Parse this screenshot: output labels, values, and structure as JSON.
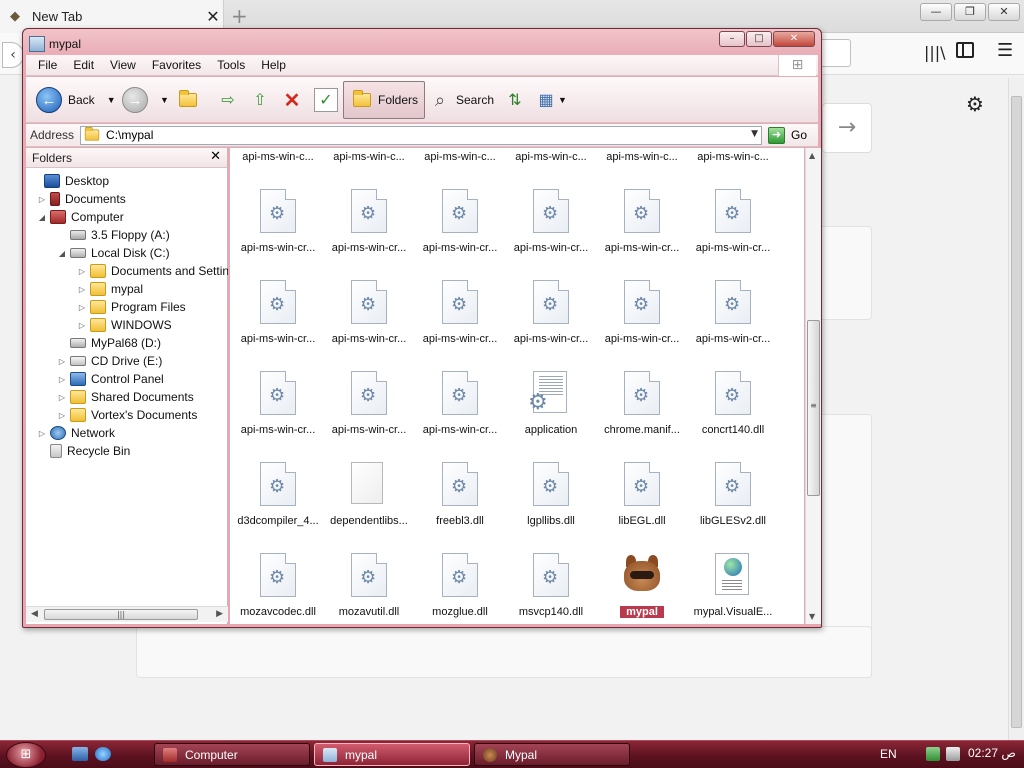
{
  "browser": {
    "tab_title": "New Tab",
    "close_tab": "✕",
    "new_tab": "+",
    "window_controls": [
      "—",
      "❐",
      "✕"
    ],
    "library_icon": "library-icon",
    "sidebar_icon": "sidebar-icon",
    "menu_icon": "hamburger-menu-icon",
    "gear_icon": "⚙",
    "go_arrow": "→"
  },
  "explorer": {
    "title": "mypal",
    "controls": [
      "–",
      "□",
      "✕"
    ],
    "menu": [
      "File",
      "Edit",
      "View",
      "Favorites",
      "Tools",
      "Help"
    ],
    "toolbar": {
      "back": "Back",
      "folders": "Folders",
      "search": "Search"
    },
    "address": {
      "label": "Address",
      "value": "C:\\mypal",
      "go": "Go"
    },
    "folders_pane": {
      "title": "Folders",
      "tree": [
        {
          "label": "Desktop",
          "icon": "desktop",
          "level": 0,
          "expander": ""
        },
        {
          "label": "Documents",
          "icon": "docs",
          "level": 1,
          "expander": "▷"
        },
        {
          "label": "Computer",
          "icon": "computer",
          "level": 1,
          "expander": "◢"
        },
        {
          "label": "3.5 Floppy (A:)",
          "icon": "floppy",
          "level": 2,
          "expander": ""
        },
        {
          "label": "Local Disk (C:)",
          "icon": "disk",
          "level": 2,
          "expander": "◢"
        },
        {
          "label": "Documents and Settings",
          "icon": "folder",
          "level": 3,
          "expander": "▷"
        },
        {
          "label": "mypal",
          "icon": "folder",
          "level": 3,
          "expander": "▷"
        },
        {
          "label": "Program Files",
          "icon": "folder",
          "level": 3,
          "expander": "▷"
        },
        {
          "label": "WINDOWS",
          "icon": "folder",
          "level": 3,
          "expander": "▷"
        },
        {
          "label": "MyPal68 (D:)",
          "icon": "disk",
          "level": 2,
          "expander": ""
        },
        {
          "label": "CD Drive (E:)",
          "icon": "cd",
          "level": 2,
          "expander": "▷"
        },
        {
          "label": "Control Panel",
          "icon": "cp",
          "level": 2,
          "expander": "▷"
        },
        {
          "label": "Shared Documents",
          "icon": "folder",
          "level": 2,
          "expander": "▷"
        },
        {
          "label": "Vortex's Documents",
          "icon": "folder",
          "level": 2,
          "expander": "▷"
        },
        {
          "label": "Network",
          "icon": "network",
          "level": 1,
          "expander": "▷"
        },
        {
          "label": "Recycle Bin",
          "icon": "bin",
          "level": 1,
          "expander": ""
        }
      ]
    },
    "files": [
      {
        "name": "api-ms-win-c...",
        "type": "dll"
      },
      {
        "name": "api-ms-win-c...",
        "type": "dll"
      },
      {
        "name": "api-ms-win-c...",
        "type": "dll"
      },
      {
        "name": "api-ms-win-c...",
        "type": "dll"
      },
      {
        "name": "api-ms-win-c...",
        "type": "dll"
      },
      {
        "name": "api-ms-win-c...",
        "type": "dll"
      },
      {
        "name": "api-ms-win-cr...",
        "type": "dll"
      },
      {
        "name": "api-ms-win-cr...",
        "type": "dll"
      },
      {
        "name": "api-ms-win-cr...",
        "type": "dll"
      },
      {
        "name": "api-ms-win-cr...",
        "type": "dll"
      },
      {
        "name": "api-ms-win-cr...",
        "type": "dll"
      },
      {
        "name": "api-ms-win-cr...",
        "type": "dll"
      },
      {
        "name": "api-ms-win-cr...",
        "type": "dll"
      },
      {
        "name": "api-ms-win-cr...",
        "type": "dll"
      },
      {
        "name": "api-ms-win-cr...",
        "type": "dll"
      },
      {
        "name": "api-ms-win-cr...",
        "type": "dll"
      },
      {
        "name": "api-ms-win-cr...",
        "type": "dll"
      },
      {
        "name": "api-ms-win-cr...",
        "type": "dll"
      },
      {
        "name": "api-ms-win-cr...",
        "type": "dll"
      },
      {
        "name": "api-ms-win-cr...",
        "type": "dll"
      },
      {
        "name": "api-ms-win-cr...",
        "type": "dll"
      },
      {
        "name": "application",
        "type": "app"
      },
      {
        "name": "chrome.manif...",
        "type": "dll"
      },
      {
        "name": "concrt140.dll",
        "type": "dll"
      },
      {
        "name": "d3dcompiler_4...",
        "type": "dll"
      },
      {
        "name": "dependentlibs...",
        "type": "blank"
      },
      {
        "name": "freebl3.dll",
        "type": "dll"
      },
      {
        "name": "lgpllibs.dll",
        "type": "dll"
      },
      {
        "name": "libEGL.dll",
        "type": "dll"
      },
      {
        "name": "libGLESv2.dll",
        "type": "dll"
      },
      {
        "name": "mozavcodec.dll",
        "type": "dll"
      },
      {
        "name": "mozavutil.dll",
        "type": "dll"
      },
      {
        "name": "mozglue.dll",
        "type": "dll"
      },
      {
        "name": "msvcp140.dll",
        "type": "dll"
      },
      {
        "name": "mypal",
        "type": "exe",
        "selected": true
      },
      {
        "name": "mypal.VisualE...",
        "type": "web"
      }
    ]
  },
  "taskbar": {
    "start_label": "start-orb",
    "tasks": [
      {
        "label": "Computer",
        "active": false
      },
      {
        "label": "mypal",
        "active": true
      },
      {
        "label": "Mypal",
        "active": false
      }
    ],
    "language": "EN",
    "clock": "02:27 ص"
  },
  "colors": {
    "window_frame": "#e7a6b1",
    "taskbar": "#5d1220",
    "selection": "#b83a4c"
  }
}
